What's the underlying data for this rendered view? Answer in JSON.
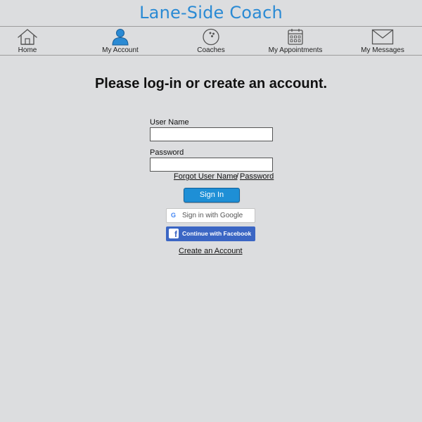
{
  "app": {
    "title": "Lane-Side Coach"
  },
  "nav": {
    "items": [
      {
        "label": "Home",
        "icon": "home-icon"
      },
      {
        "label": "My Account",
        "icon": "user-icon"
      },
      {
        "label": "Coaches",
        "icon": "bowling-ball-icon"
      },
      {
        "label": "My Appointments",
        "icon": "calendar-icon"
      },
      {
        "label": "My Messages",
        "icon": "envelope-icon"
      }
    ],
    "active_color": "#2a8ad4"
  },
  "login": {
    "heading": "Please log-in or create an account.",
    "username_label": "User Name",
    "username_value": "",
    "password_label": "Password",
    "password_value": "",
    "forgot_username": "Forgot User Name",
    "forgot_separator": "/",
    "forgot_password": "Password",
    "signin_label": "Sign In",
    "google_label": "Sign in with Google",
    "google_icon": "G",
    "facebook_label": "Continue with Facebook",
    "facebook_icon": "f",
    "create_account": "Create an Account"
  },
  "colors": {
    "background": "#dcdddf",
    "brand": "#2a8ad4",
    "signin_button": "#1e8fd6",
    "facebook": "#3b66c4"
  }
}
